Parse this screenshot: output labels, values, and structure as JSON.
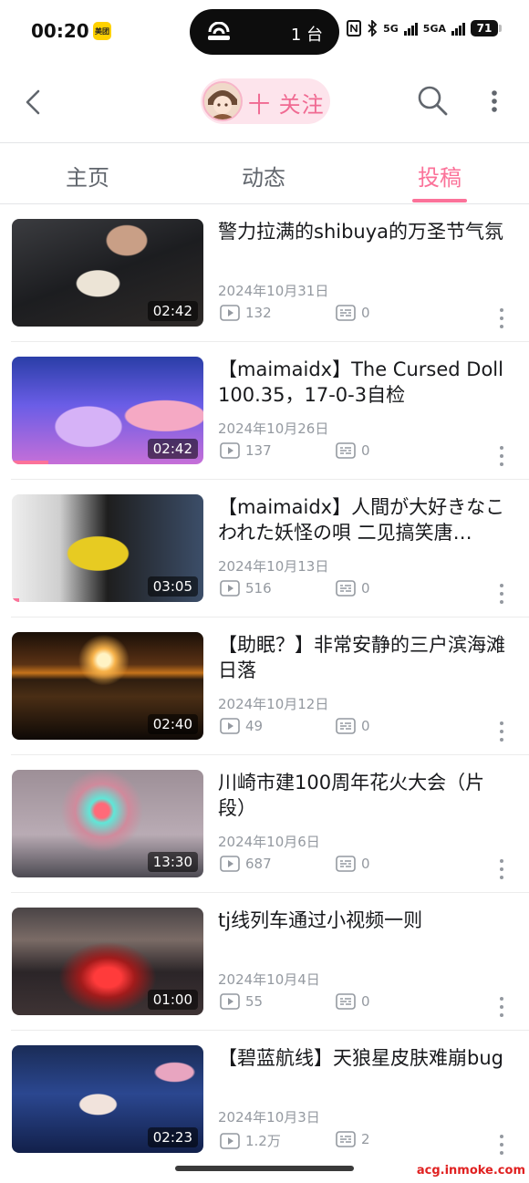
{
  "status_bar": {
    "time": "00:20",
    "app_badge": "美团",
    "island_text": "1 台",
    "network_1": "5G",
    "network_2": "5GA",
    "battery": "71"
  },
  "nav": {
    "follow_label": "十 关注"
  },
  "tabs": [
    {
      "label": "主页",
      "active": false
    },
    {
      "label": "动态",
      "active": false
    },
    {
      "label": "投稿",
      "active": true
    }
  ],
  "accent_color": "#fb7299",
  "videos": [
    {
      "title": "警力拉满的shibuya的万圣节气氛",
      "date": "2024年10月31日",
      "plays": "132",
      "danmaku": "0",
      "duration": "02:42",
      "watched_fraction": 0
    },
    {
      "title": "【maimaidx】The Cursed Doll 100.35，17-0-3自检",
      "date": "2024年10月26日",
      "plays": "137",
      "danmaku": "0",
      "duration": "02:42",
      "watched_fraction": 0.19
    },
    {
      "title": "【maimaidx】人間が大好きなこわれた妖怪の唄 二见搞笑唐…",
      "date": "2024年10月13日",
      "plays": "516",
      "danmaku": "0",
      "duration": "03:05",
      "watched_fraction": 0.04
    },
    {
      "title": "【助眠？】非常安静的三户滨海滩日落",
      "date": "2024年10月12日",
      "plays": "49",
      "danmaku": "0",
      "duration": "02:40",
      "watched_fraction": 0
    },
    {
      "title": "川崎市建100周年花火大会（片段）",
      "date": "2024年10月6日",
      "plays": "687",
      "danmaku": "0",
      "duration": "13:30",
      "watched_fraction": 0
    },
    {
      "title": "tj线列车通过小视频一则",
      "date": "2024年10月4日",
      "plays": "55",
      "danmaku": "0",
      "duration": "01:00",
      "watched_fraction": 0
    },
    {
      "title": "【碧蓝航线】天狼星皮肤难崩bug",
      "date": "2024年10月3日",
      "plays": "1.2万",
      "danmaku": "2",
      "duration": "02:23",
      "watched_fraction": 0
    }
  ],
  "watermark": "acg.inmoke.com"
}
